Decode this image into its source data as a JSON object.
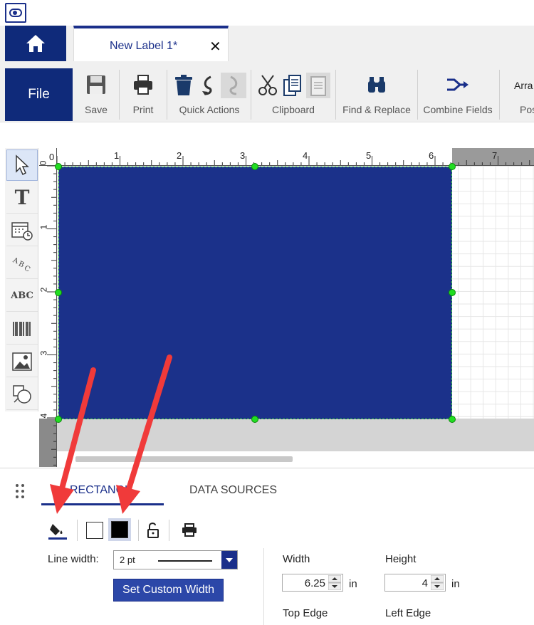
{
  "tabs": [
    {
      "label": "New Label 1*",
      "active": true
    }
  ],
  "ribbon": {
    "file_label": "File",
    "groups": [
      {
        "label": "Save"
      },
      {
        "label": "Print"
      },
      {
        "label": "Quick Actions"
      },
      {
        "label": "Clipboard"
      },
      {
        "label": "Find & Replace"
      },
      {
        "label": "Combine Fields"
      },
      {
        "label": "Pos"
      }
    ],
    "arrange_label": "Arra"
  },
  "ruler": {
    "top": [
      "0",
      "1",
      "2",
      "3",
      "4",
      "5",
      "6",
      "7"
    ],
    "left": [
      "0",
      "1",
      "2",
      "3",
      "4"
    ]
  },
  "properties": {
    "tabs": [
      {
        "label": "RECTANGLE",
        "active": true
      },
      {
        "label": "DATA SOURCES",
        "active": false
      }
    ],
    "line_width_label": "Line width:",
    "line_width_value": "2 pt",
    "custom_width_button": "Set Custom Width",
    "width_label": "Width",
    "width_value": "6.25",
    "width_unit": "in",
    "height_label": "Height",
    "height_value": "4",
    "height_unit": "in",
    "top_edge_label": "Top Edge",
    "left_edge_label": "Left Edge"
  },
  "colors": {
    "brand": "#0f2a7a",
    "rectangle_fill": "#1b318a",
    "handle": "#22dd22",
    "annotation_arrow": "#f03a3a"
  }
}
